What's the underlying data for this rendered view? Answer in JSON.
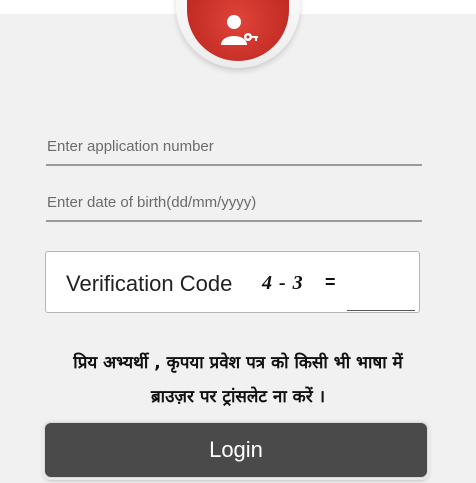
{
  "form": {
    "application_placeholder": "Enter application number",
    "dob_placeholder": "Enter date of birth(dd/mm/yyyy)"
  },
  "captcha": {
    "label": "Verification Code",
    "code": "4 - 3",
    "equals": "="
  },
  "notice": {
    "line1": "प्रिय अभ्यर्थी , कृपया प्रवेश पत्र को किसी भी भाषा में",
    "line2": "ब्राउज़र पर ट्रांसलेट ना करें ।"
  },
  "login": {
    "label": "Login"
  },
  "colors": {
    "accent_red": "#c8302a",
    "button_bg": "#4a4a4a"
  },
  "icons": {
    "header": "user-key-icon"
  }
}
